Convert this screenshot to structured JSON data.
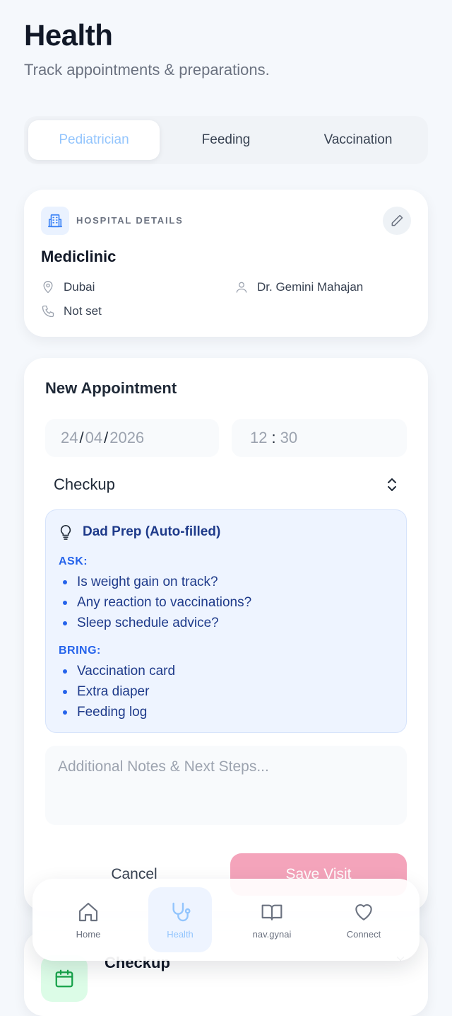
{
  "header": {
    "title": "Health",
    "subtitle": "Track appointments & preparations."
  },
  "tabs": [
    {
      "label": "Pediatrician",
      "active": true
    },
    {
      "label": "Feeding",
      "active": false
    },
    {
      "label": "Vaccination",
      "active": false
    }
  ],
  "hospital": {
    "section_label": "HOSPITAL DETAILS",
    "name": "Mediclinic",
    "location": "Dubai",
    "doctor": "Dr. Gemini Mahajan",
    "phone": "Not set",
    "icons": [
      "building-icon",
      "pencil-icon",
      "map-pin-icon",
      "user-icon",
      "phone-icon"
    ]
  },
  "appointment": {
    "title": "New Appointment",
    "date": {
      "day": "24",
      "month": "04",
      "year": "2026",
      "separator": "/"
    },
    "time": {
      "hour": "12",
      "minute": "30",
      "separator": ":"
    },
    "type_value": "Checkup",
    "prep": {
      "title": "Dad Prep (Auto-filled)",
      "ask_label": "ASK:",
      "ask_items": [
        "Is weight gain on track?",
        "Any reaction to vaccinations?",
        "Sleep schedule advice?"
      ],
      "bring_label": "BRING:",
      "bring_items": [
        "Vaccination card",
        "Extra diaper",
        "Feeding log"
      ]
    },
    "notes_placeholder": "Additional Notes & Next Steps...",
    "cancel_label": "Cancel",
    "save_label": "Save Visit"
  },
  "visit_card": {
    "title": "Checkup"
  },
  "nav": {
    "items": [
      {
        "label": "Home",
        "icon": "home-icon",
        "active": false
      },
      {
        "label": "Health",
        "icon": "stethoscope-icon",
        "active": true
      },
      {
        "label": "nav.gynai",
        "icon": "book-open-icon",
        "active": false
      },
      {
        "label": "Connect",
        "icon": "heart-icon",
        "active": false
      }
    ]
  },
  "colors": {
    "accent_blue": "#93c5fd",
    "prep_text": "#1e3a8a",
    "prep_label": "#2563eb",
    "save_button": "#f4a4bb",
    "background": "#f5f8fc"
  }
}
